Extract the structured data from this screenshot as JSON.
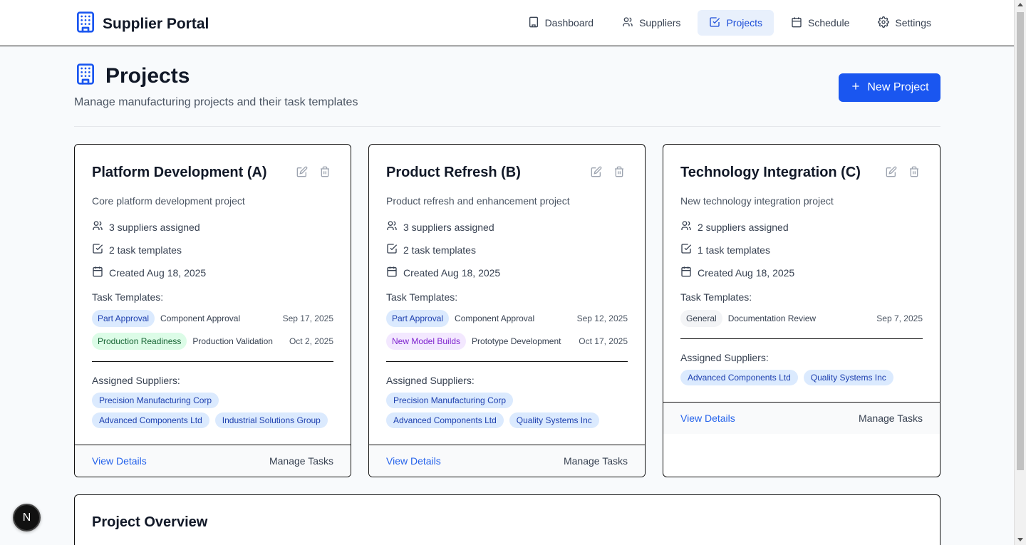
{
  "app": {
    "title": "Supplier Portal"
  },
  "nav": [
    {
      "label": "Dashboard",
      "icon": "building-icon",
      "active": false
    },
    {
      "label": "Suppliers",
      "icon": "users-icon",
      "active": false
    },
    {
      "label": "Projects",
      "icon": "check-square-icon",
      "active": true
    },
    {
      "label": "Schedule",
      "icon": "calendar-icon",
      "active": false
    },
    {
      "label": "Settings",
      "icon": "gear-icon",
      "active": false
    }
  ],
  "page": {
    "title": "Projects",
    "subtitle": "Manage manufacturing projects and their task templates",
    "new_button": "New Project"
  },
  "labels": {
    "task_templates": "Task Templates:",
    "assigned_suppliers": "Assigned Suppliers:",
    "view_details": "View Details",
    "manage_tasks": "Manage Tasks"
  },
  "projects": [
    {
      "name": "Platform Development (A)",
      "description": "Core platform development project",
      "suppliers_count": "3 suppliers assigned",
      "templates_count": "2 task templates",
      "created": "Created Aug 18, 2025",
      "templates": [
        {
          "tag": "Part Approval",
          "color": "blue",
          "name": "Component Approval",
          "date": "Sep 17, 2025"
        },
        {
          "tag": "Production Readiness",
          "color": "green",
          "name": "Production Validation",
          "date": "Oct 2, 2025"
        }
      ],
      "suppliers": [
        "Precision Manufacturing Corp",
        "Advanced Components Ltd",
        "Industrial Solutions Group"
      ]
    },
    {
      "name": "Product Refresh (B)",
      "description": "Product refresh and enhancement project",
      "suppliers_count": "3 suppliers assigned",
      "templates_count": "2 task templates",
      "created": "Created Aug 18, 2025",
      "templates": [
        {
          "tag": "Part Approval",
          "color": "blue",
          "name": "Component Approval",
          "date": "Sep 12, 2025"
        },
        {
          "tag": "New Model Builds",
          "color": "purple",
          "name": "Prototype Development",
          "date": "Oct 17, 2025"
        }
      ],
      "suppliers": [
        "Precision Manufacturing Corp",
        "Advanced Components Ltd",
        "Quality Systems Inc"
      ]
    },
    {
      "name": "Technology Integration (C)",
      "description": "New technology integration project",
      "suppliers_count": "2 suppliers assigned",
      "templates_count": "1 task templates",
      "created": "Created Aug 18, 2025",
      "templates": [
        {
          "tag": "General",
          "color": "gray",
          "name": "Documentation Review",
          "date": "Sep 7, 2025"
        }
      ],
      "suppliers": [
        "Advanced Components Ltd",
        "Quality Systems Inc"
      ]
    }
  ],
  "overview": {
    "title": "Project Overview"
  },
  "badge": {
    "letter": "N"
  },
  "colors": {
    "accent": "#1a56f0",
    "link": "#2563eb"
  }
}
